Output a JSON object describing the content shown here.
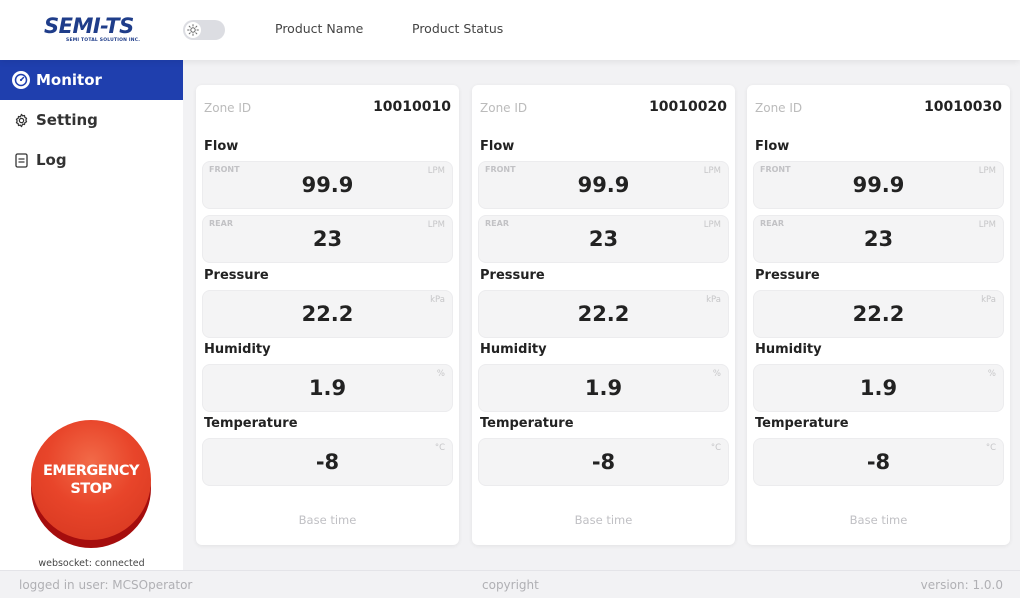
{
  "header": {
    "logo_text": "SEMI-TS",
    "logo_subtext": "SEMI TOTAL SOLUTION INC.",
    "toggle_icon": "sun-icon",
    "links": [
      "Product Name",
      "Product Status"
    ]
  },
  "sidebar": {
    "items": [
      {
        "label": "Monitor",
        "icon": "gauge-icon",
        "active": true
      },
      {
        "label": "Setting",
        "icon": "gear-icon",
        "active": false
      },
      {
        "label": "Log",
        "icon": "document-icon",
        "active": false
      }
    ],
    "emergency_line1": "EMERGENCY",
    "emergency_line2": "STOP",
    "websocket_status": "websocket: connected"
  },
  "labels": {
    "zone_id": "Zone ID",
    "flow": "Flow",
    "pressure": "Pressure",
    "humidity": "Humidity",
    "temperature": "Temperature",
    "front": "FRONT",
    "rear": "REAR",
    "base_time": "Base time"
  },
  "units": {
    "flow": "LPM",
    "pressure": "kPa",
    "humidity": "%",
    "temperature": "°C"
  },
  "zones": [
    {
      "id": "10010010",
      "flow_front": "99.9",
      "flow_rear": "23",
      "pressure": "22.2",
      "humidity": "1.9",
      "temperature": "-8"
    },
    {
      "id": "10010020",
      "flow_front": "99.9",
      "flow_rear": "23",
      "pressure": "22.2",
      "humidity": "1.9",
      "temperature": "-8"
    },
    {
      "id": "10010030",
      "flow_front": "99.9",
      "flow_rear": "23",
      "pressure": "22.2",
      "humidity": "1.9",
      "temperature": "-8"
    }
  ],
  "footer": {
    "logged_in": "logged in user: MCSOperator",
    "copyright": "copyright",
    "version": "version: 1.0.0"
  },
  "colors": {
    "accent": "#1f3fae",
    "logo": "#1f3d8a",
    "emergency": "#e8452a"
  }
}
